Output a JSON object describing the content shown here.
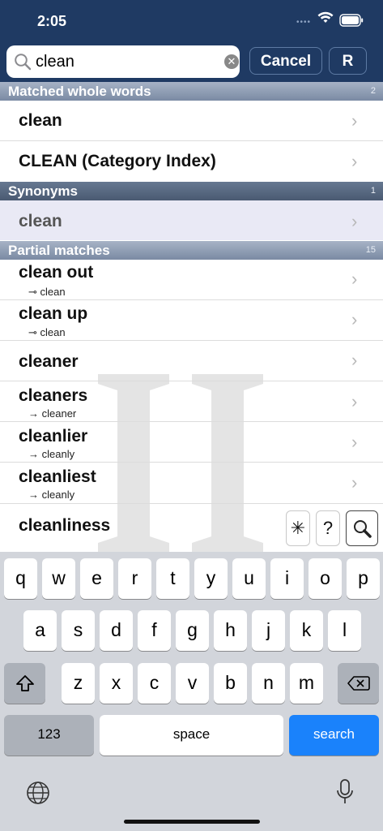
{
  "status": {
    "time": "2:05"
  },
  "search": {
    "query": "clean",
    "cancel_label": "Cancel",
    "r_label": "R"
  },
  "sections": {
    "whole": {
      "title": "Matched whole words",
      "count": "2"
    },
    "synonyms": {
      "title": "Synonyms",
      "count": "1"
    },
    "partial": {
      "title": "Partial matches",
      "count": "15"
    }
  },
  "whole_words": [
    {
      "word": "clean"
    },
    {
      "word": "CLEAN (Category Index)"
    }
  ],
  "synonyms": [
    {
      "word": "clean"
    }
  ],
  "partial": [
    {
      "word": "clean out",
      "sub": "⊸ clean"
    },
    {
      "word": "clean up",
      "sub": "⊸ clean"
    },
    {
      "word": "cleaner",
      "sub": ""
    },
    {
      "word": "cleaners",
      "sub": "→ cleaner"
    },
    {
      "word": "cleanlier",
      "sub": "→ cleanly"
    },
    {
      "word": "cleanliest",
      "sub": "→ cleanly"
    },
    {
      "word": "cleanliness",
      "sub": ""
    }
  ],
  "tools": {
    "star": "✳",
    "question": "?"
  },
  "keyboard": {
    "row1": [
      "q",
      "w",
      "e",
      "r",
      "t",
      "y",
      "u",
      "i",
      "o",
      "p"
    ],
    "row2": [
      "a",
      "s",
      "d",
      "f",
      "g",
      "h",
      "j",
      "k",
      "l"
    ],
    "row3": [
      "z",
      "x",
      "c",
      "v",
      "b",
      "n",
      "m"
    ],
    "numbers": "123",
    "space": "space",
    "search": "search"
  },
  "colors": {
    "accent": "#1f3a63",
    "search_key": "#1a82fb"
  },
  "icons": [
    "wifi-icon",
    "battery-icon",
    "search-icon",
    "clear-icon",
    "chevron-right-icon",
    "shift-icon",
    "backspace-icon",
    "globe-icon",
    "microphone-icon"
  ]
}
